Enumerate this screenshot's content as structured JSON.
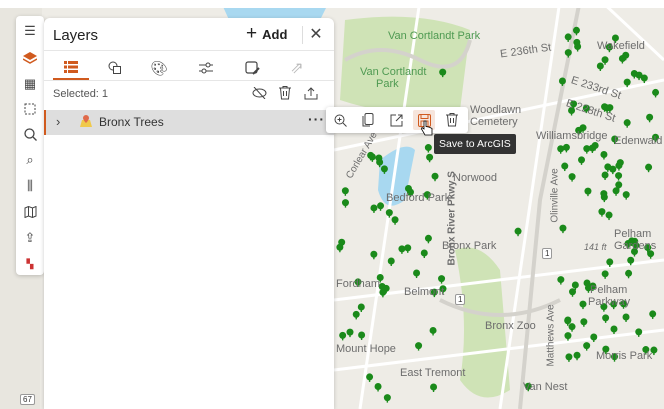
{
  "panel": {
    "title": "Layers",
    "add_label": "Add",
    "close_icon": "close-icon"
  },
  "tabs": [
    {
      "name": "layers-list",
      "icon": "list-icon",
      "active": true
    },
    {
      "name": "create",
      "icon": "shapes-icon"
    },
    {
      "name": "style",
      "icon": "palette-icon"
    },
    {
      "name": "properties",
      "icon": "sliders-icon"
    },
    {
      "name": "edit",
      "icon": "edit-icon"
    },
    {
      "name": "share",
      "icon": "share-icon",
      "disabled": true
    }
  ],
  "selection": {
    "label": "Selected: 1"
  },
  "layers": [
    {
      "name": "Bronx Trees"
    }
  ],
  "layer_actions": [
    "zoom-to",
    "duplicate",
    "open",
    "save",
    "delete"
  ],
  "tooltip": "Save to ArcGIS",
  "map_labels": {
    "vcp1": "Van Cortlandt Park",
    "vcp2a": "Van Cortlandt",
    "vcp2b": "Park",
    "e236": "E 236th St",
    "e233": "E 233rd St",
    "e228": "E 228th St",
    "wood1": "Woodlawn",
    "wood2": "Cemetery",
    "williams": "Williamsbridge",
    "edenwald": "Edenwald",
    "norwood": "Norwood",
    "bedford": "Bedford Park",
    "bronxpark": "Bronx Park",
    "brp": "Bronx River Pkwy S",
    "olinville": "Olinville Ave",
    "pelhamg1": "Pelham",
    "pelhamg2": "Gardens",
    "pelhamp1": "Pelham",
    "pelhamp2": "Parkway",
    "bronxzoo": "Bronx Zoo",
    "belmont": "Belmont",
    "fordham": "Fordham",
    "mounthope": "Mount Hope",
    "easttremont": "East Tremont",
    "vannest": "Van Nest",
    "matthews": "Matthews Ave",
    "morris": "Morris Park",
    "elev": "141 ft",
    "r1": "1",
    "r67": "67",
    "corlear": "Corlear Ave",
    "wakefield": "Wakefield"
  },
  "colors": {
    "accent": "#d05a1e",
    "tree": "#1a8a1a",
    "water": "#a8d8f0",
    "park": "#cfe3b6"
  }
}
